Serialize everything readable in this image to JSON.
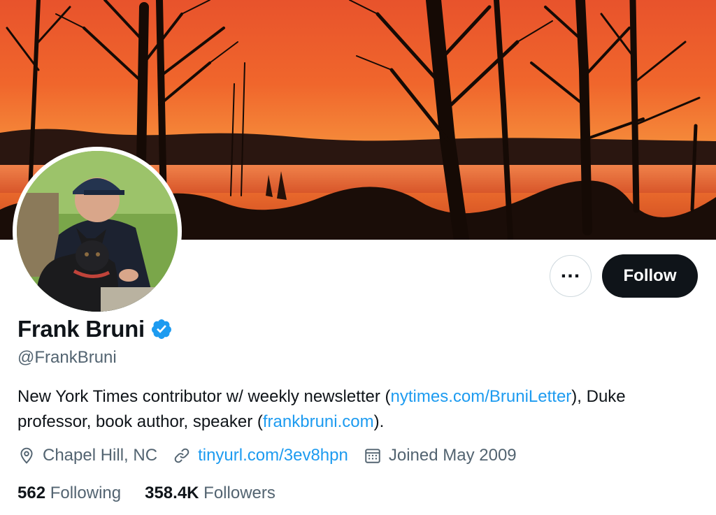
{
  "profile": {
    "name": "Frank Bruni",
    "handle": "@FrankBruni",
    "verified_color": "#1d9bf0",
    "bio": {
      "part1": "New York Times contributor w/ weekly newsletter (",
      "link1": "nytimes.com/BruniLetter",
      "part2": "), Duke professor, book author, speaker (",
      "link2": "frankbruni.com",
      "part3": ")."
    },
    "location": "Chapel Hill, NC",
    "website": "tinyurl.com/3ev8hpn",
    "joined": "Joined May 2009",
    "following_count": "562",
    "following_label": "Following",
    "followers_count": "358.4K",
    "followers_label": "Followers"
  },
  "actions": {
    "more_label": "…",
    "follow_label": "Follow"
  },
  "icons": {
    "location": "location-pin-icon",
    "link": "link-icon",
    "calendar": "calendar-icon",
    "verified": "verified-badge-icon"
  },
  "colors": {
    "accent": "#1d9bf0",
    "text": "#0f1419",
    "muted": "#536471"
  }
}
